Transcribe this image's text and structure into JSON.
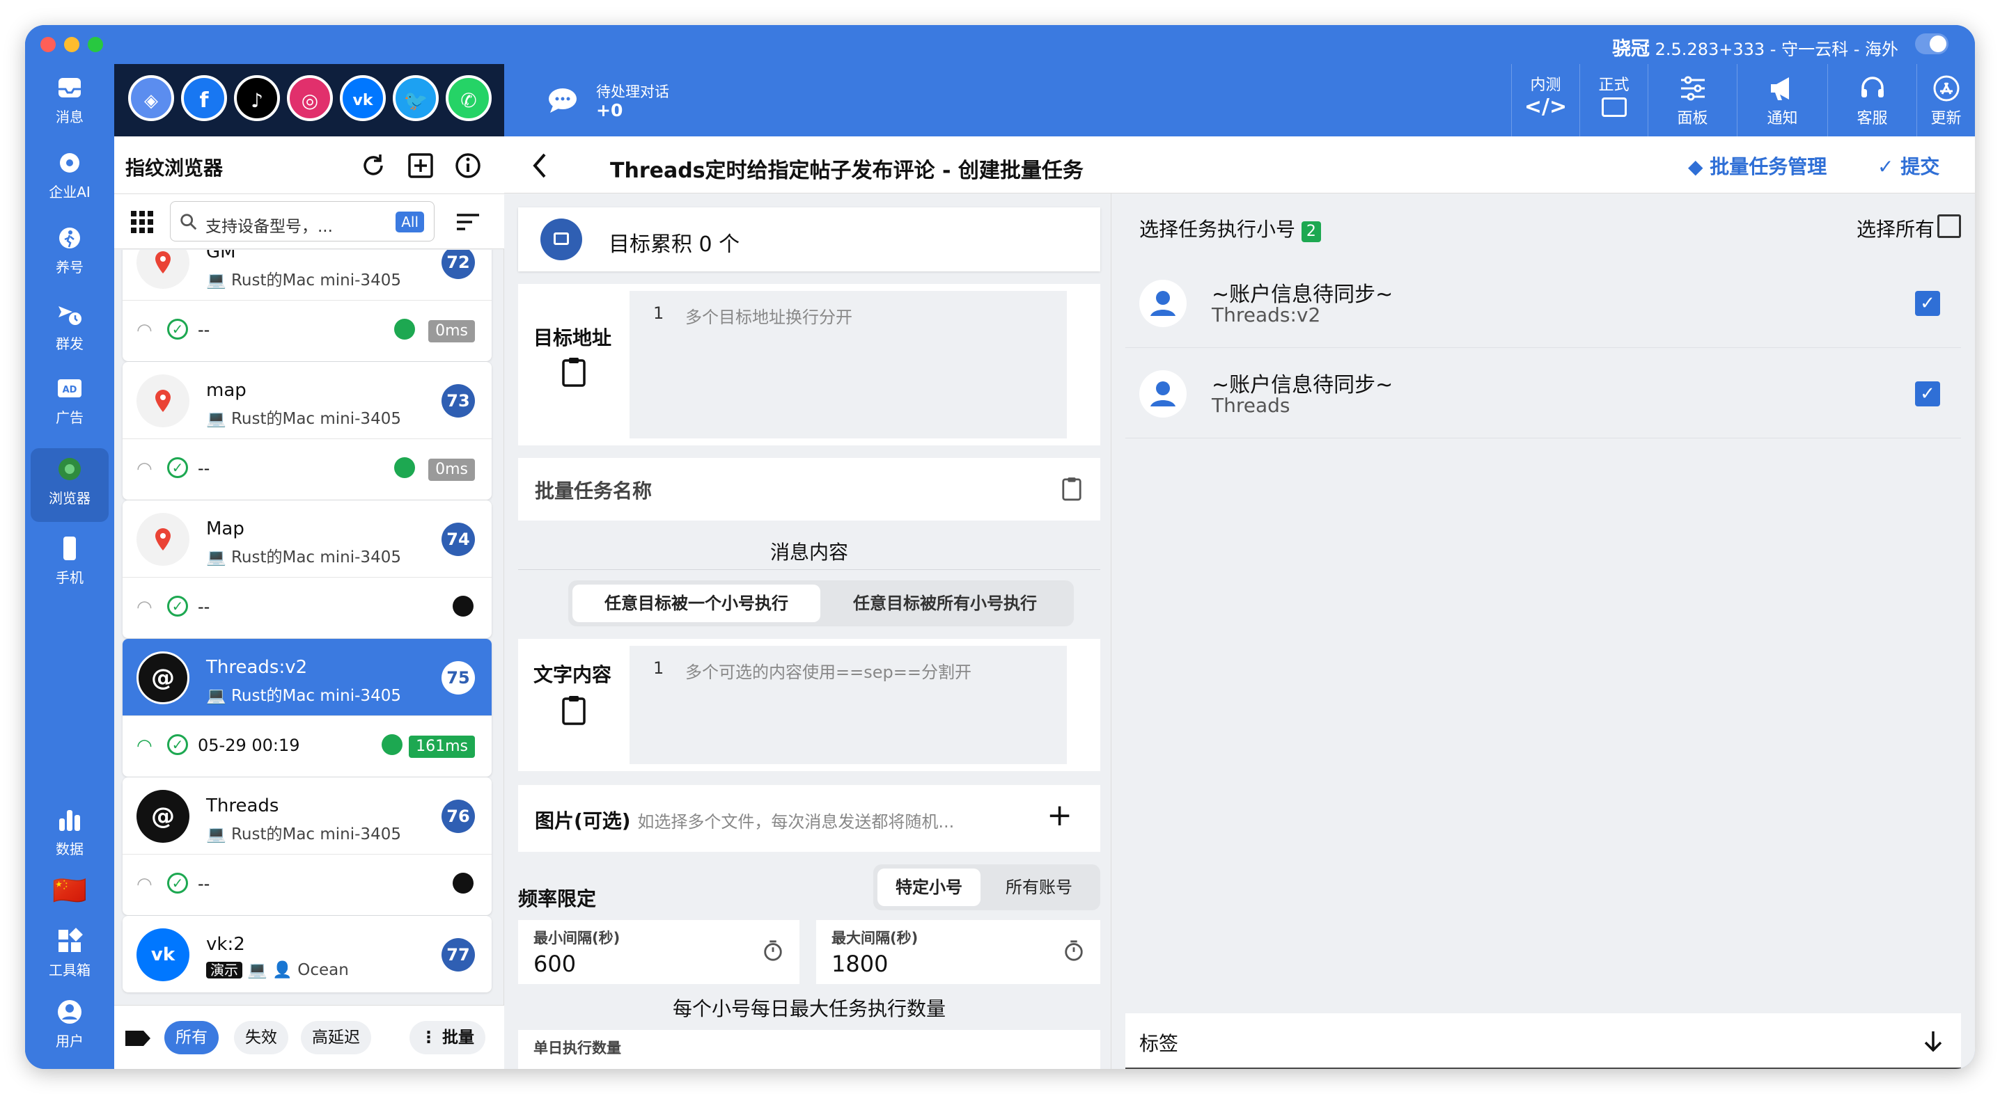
{
  "window": {
    "app_name": "骁冠",
    "title_rest": "2.5.283+333 - 守一云科 - 海外"
  },
  "rail": [
    {
      "label": "消息",
      "icon": "inbox-icon"
    },
    {
      "label": "企业AI",
      "icon": "ai-gear-icon"
    },
    {
      "label": "养号",
      "icon": "person-walk-icon"
    },
    {
      "label": "群发",
      "icon": "broadcast-icon"
    },
    {
      "label": "广告",
      "icon": "ad-icon"
    },
    {
      "label": "浏览器",
      "icon": "chrome-icon"
    },
    {
      "label": "手机",
      "icon": "phone-icon"
    },
    {
      "label": "数据",
      "icon": "bar-chart-icon"
    },
    {
      "label": "工具箱",
      "icon": "widgets-icon"
    },
    {
      "label": "用户",
      "icon": "user-icon"
    }
  ],
  "flag": "🇨🇳",
  "appbar": {
    "pending_label": "待处理对话",
    "pending_count": "+0",
    "buttons": [
      {
        "label": "内测",
        "icon": "code-icon"
      },
      {
        "label": "正式",
        "icon": "screen-icon"
      },
      {
        "label": "面板",
        "icon": "sliders-icon"
      },
      {
        "label": "通知",
        "icon": "megaphone-icon"
      },
      {
        "label": "客服",
        "icon": "headset-icon"
      },
      {
        "label": "更新",
        "icon": "appstore-icon"
      }
    ]
  },
  "left": {
    "title": "指纹浏览器",
    "search_placeholder": "支持设备型号，...",
    "search_badge": "All",
    "cards": [
      {
        "name": "GM",
        "device": "Rust的Mac mini-3405",
        "num": "72",
        "time": "--",
        "ms": "0ms",
        "icon": "maps"
      },
      {
        "name": "map",
        "device": "Rust的Mac mini-3405",
        "num": "73",
        "time": "--",
        "ms": "0ms",
        "icon": "maps"
      },
      {
        "name": "Map",
        "device": "Rust的Mac mini-3405",
        "num": "74",
        "time": "--",
        "ms": "",
        "icon": "maps"
      },
      {
        "name": "Threads:v2",
        "device": "Rust的Mac mini-3405",
        "num": "75",
        "time": "05-29 00:19",
        "ms": "161ms",
        "icon": "threads"
      },
      {
        "name": "Threads",
        "device": "Rust的Mac mini-3405",
        "num": "76",
        "time": "--",
        "ms": "",
        "icon": "threads"
      },
      {
        "name": "vk:2",
        "device": "Ocean",
        "num": "77",
        "tag": "演示",
        "icon": "vk"
      }
    ],
    "filters": [
      "所有",
      "失效",
      "高延迟"
    ],
    "batch_label": "批量"
  },
  "main": {
    "title": "Threads定时给指定帖子发布评论 - 创建批量任务",
    "manage_label": "批量任务管理",
    "submit_label": "提交",
    "target_count": "目标累积 0 个",
    "target_addr_label": "目标地址",
    "target_addr_placeholder": "多个目标地址换行分开",
    "line_no": "1",
    "batch_name_label": "批量任务名称",
    "message_section": "消息内容",
    "seg1": [
      "任意目标被一个小号执行",
      "任意目标被所有小号执行"
    ],
    "text_label": "文字内容",
    "text_placeholder": "多个可选的内容使用==sep==分割开",
    "image_label": "图片(可选)",
    "image_hint": "如选择多个文件，每次消息发送都将随机...",
    "freq_label": "频率限定",
    "seg2": [
      "特定小号",
      "所有账号"
    ],
    "min_label": "最小间隔(秒)",
    "min_value": "600",
    "max_label": "最大间隔(秒)",
    "max_value": "1800",
    "daily_label": "每个小号每日最大任务执行数量",
    "single_label": "单日执行数量"
  },
  "accounts": {
    "title": "选择任务执行小号",
    "count": "2",
    "select_all": "选择所有",
    "items": [
      {
        "name": "~账户信息待同步~",
        "sub": "Threads:v2",
        "checked": true
      },
      {
        "name": "~账户信息待同步~",
        "sub": "Threads",
        "checked": true
      }
    ],
    "tags_label": "标签"
  },
  "colors": {
    "primary": "#3b7ae0",
    "dark": "#0e1f3d",
    "green": "#1da851",
    "badge": "#2f5fb3"
  }
}
